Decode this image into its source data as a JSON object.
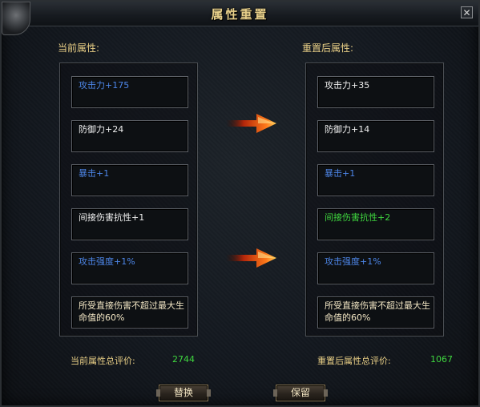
{
  "window": {
    "title": "属性重置",
    "close_glyph": "✕"
  },
  "current": {
    "label": "当前属性:",
    "attributes": [
      {
        "text": "攻击力+175",
        "color": "#4d86e8"
      },
      {
        "text": "防御力+24",
        "color": "#f0f0f0"
      },
      {
        "text": "暴击+1",
        "color": "#4d86e8"
      },
      {
        "text": "间接伤害抗性+1",
        "color": "#f0f0f0"
      },
      {
        "text": "攻击强度+1%",
        "color": "#4d86e8"
      },
      {
        "text": "所受直接伤害不超过最大生命值的60%",
        "color": "#f2e6c4"
      }
    ],
    "score_label": "当前属性总评价:",
    "score_value": "2744"
  },
  "reset": {
    "label": "重置后属性:",
    "attributes": [
      {
        "text": "攻击力+35",
        "color": "#f0f0f0"
      },
      {
        "text": "防御力+14",
        "color": "#f0f0f0"
      },
      {
        "text": "暴击+1",
        "color": "#4d86e8"
      },
      {
        "text": "间接伤害抗性+2",
        "color": "#3fd63f"
      },
      {
        "text": "攻击强度+1%",
        "color": "#4d86e8"
      },
      {
        "text": "所受直接伤害不超过最大生命值的60%",
        "color": "#f2e6c4"
      }
    ],
    "score_label": "重置后属性总评价:",
    "score_value": "1067"
  },
  "buttons": {
    "replace": "替换",
    "keep": "保留"
  },
  "icons": {
    "arrow": "arrow-right-icon",
    "close": "close-icon",
    "corner": "ornament-icon"
  }
}
